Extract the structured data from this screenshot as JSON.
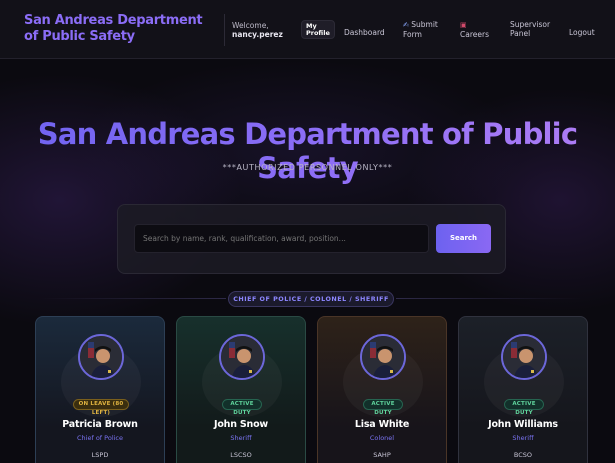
{
  "nav": {
    "brand": "San Andreas Department of Public Safety",
    "welcome_prefix": "Welcome,",
    "username": "nancy.perez",
    "my_profile": "My Profile",
    "dashboard": "Dashboard",
    "submit_form": "Submit Form",
    "careers": "Careers",
    "supervisor_panel": "Supervisor Panel",
    "logout": "Logout"
  },
  "hero": {
    "title": "San Andreas Department of Public Safety",
    "subtitle": "***AUTHORIZED PERSONNEL ONLY***"
  },
  "search": {
    "placeholder": "Search by name, rank, qualification, award, position...",
    "button": "Search"
  },
  "section": {
    "label": "CHIEF OF POLICE / COLONEL / SHERIFF"
  },
  "cards": [
    {
      "name": "Patricia Brown",
      "rank": "Chief of Police",
      "dept": "LSPD",
      "status": "ON LEAVE (80 LEFT)",
      "status_type": "leave",
      "theme": "blue"
    },
    {
      "name": "John Snow",
      "rank": "Sheriff",
      "dept": "LSCSO",
      "status": "ACTIVE DUTY",
      "status_type": "active",
      "theme": "green"
    },
    {
      "name": "Lisa White",
      "rank": "Colonel",
      "dept": "SAHP",
      "status": "ACTIVE DUTY",
      "status_type": "active",
      "theme": "orange"
    },
    {
      "name": "John Williams",
      "rank": "Sheriff",
      "dept": "BCSO",
      "status": "ACTIVE DUTY",
      "status_type": "active",
      "theme": "dark"
    }
  ],
  "colors": {
    "accent": "#8b6df6",
    "leave": "#e0b440",
    "active": "#5fd39c",
    "background": "#0b0a10"
  }
}
